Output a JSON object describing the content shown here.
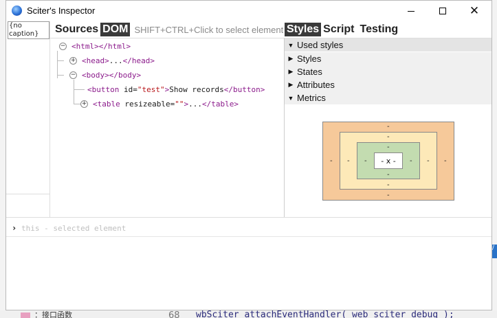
{
  "background": {
    "bottom_code": "wbSciter_attachEventHandler( web_sciter_debug );",
    "bottom_line_no": "68",
    "bottom_cn_text": "：接口函数",
    "right_badge": "/"
  },
  "window": {
    "title": "Sciter's Inspector",
    "minimize_icon": "minimize-icon",
    "maximize_icon": "maximize-icon",
    "close_glyph": "✕"
  },
  "caption": {
    "label": "{no caption}",
    "dots": "˙ ˙ ˙ ˙"
  },
  "left_tabs": {
    "sources": "Sources",
    "dom": "DOM",
    "hint": "SHIFT+CTRL+Click to select element"
  },
  "right_tabs": {
    "styles": "Styles",
    "script": "Script",
    "testing": "Testing"
  },
  "dom_tree": {
    "html_open": "<html>",
    "html_close": "</html>",
    "head_open": "<head>",
    "head_ellipsis": "...",
    "head_close": "</head>",
    "body_open": "<body>",
    "body_close": "</body>",
    "button_open_tag": "<button",
    "button_attr": " id=",
    "button_val": "\"test\"",
    "button_gt": ">",
    "button_text": "Show records",
    "button_close": "</button>",
    "table_open_tag": "<table",
    "table_attr": " resizeable=",
    "table_val": "\"\"",
    "table_gt": ">",
    "table_ellipsis": "...",
    "table_close": "</table>",
    "collapse_glyph": "−",
    "expand_glyph": "+"
  },
  "sections": {
    "used_styles": "Used styles",
    "styles": "Styles",
    "states": "States",
    "attributes": "Attributes",
    "metrics": "Metrics",
    "expanded_arrow": "▼",
    "collapsed_arrow": "▶"
  },
  "metrics": {
    "margin_top": "-",
    "margin_bottom": "-",
    "margin_left": "-",
    "margin_right": "-",
    "border_top": "-",
    "border_bottom": "-",
    "border_left": "-",
    "border_right": "-",
    "padding_top": "-",
    "padding_bottom": "-",
    "padding_left": "-",
    "padding_right": "-",
    "content": "- x -",
    "colors": {
      "margin": "#f6c99a",
      "border": "#fde9b8",
      "padding": "#c3dcb0",
      "content": "#ffffff"
    }
  },
  "console": {
    "prompt": "›",
    "placeholder": "this - selected element"
  }
}
